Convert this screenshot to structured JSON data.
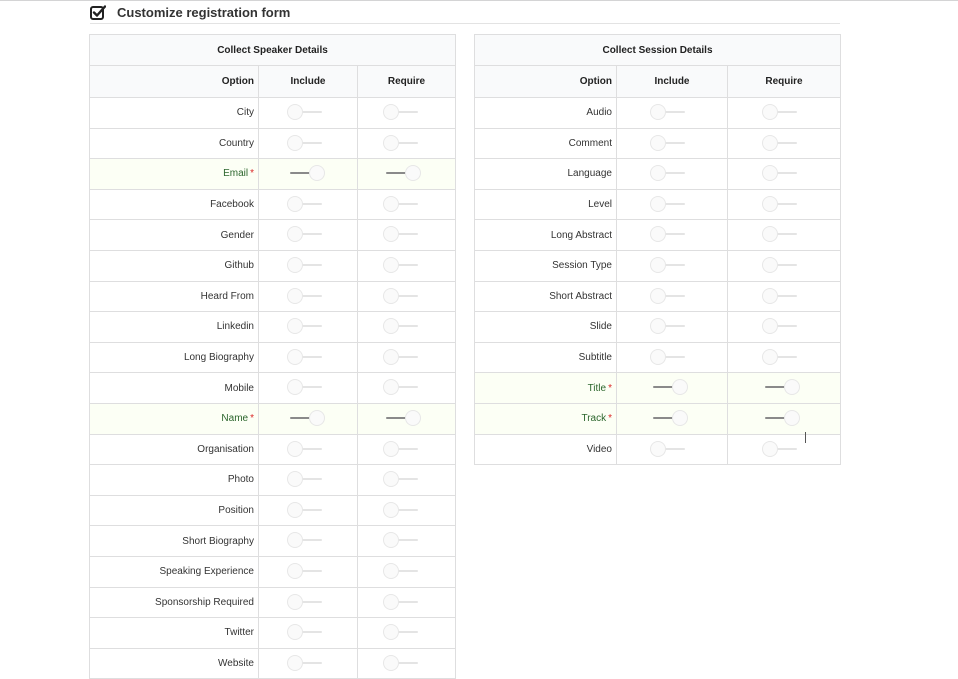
{
  "header": {
    "title": "Customize registration form",
    "checkbox_icon": "checked-checkbox-icon"
  },
  "speaker": {
    "caption": "Collect Speaker Details",
    "headers": {
      "option": "Option",
      "include": "Include",
      "require": "Require"
    },
    "rows": [
      {
        "label": "City",
        "required": false,
        "include": false,
        "require": false
      },
      {
        "label": "Country",
        "required": false,
        "include": false,
        "require": false
      },
      {
        "label": "Email",
        "required": true,
        "include": true,
        "require": true
      },
      {
        "label": "Facebook",
        "required": false,
        "include": false,
        "require": false
      },
      {
        "label": "Gender",
        "required": false,
        "include": false,
        "require": false
      },
      {
        "label": "Github",
        "required": false,
        "include": false,
        "require": false
      },
      {
        "label": "Heard From",
        "required": false,
        "include": false,
        "require": false
      },
      {
        "label": "Linkedin",
        "required": false,
        "include": false,
        "require": false
      },
      {
        "label": "Long Biography",
        "required": false,
        "include": false,
        "require": false
      },
      {
        "label": "Mobile",
        "required": false,
        "include": false,
        "require": false
      },
      {
        "label": "Name",
        "required": true,
        "include": true,
        "require": true
      },
      {
        "label": "Organisation",
        "required": false,
        "include": false,
        "require": false
      },
      {
        "label": "Photo",
        "required": false,
        "include": false,
        "require": false
      },
      {
        "label": "Position",
        "required": false,
        "include": false,
        "require": false
      },
      {
        "label": "Short Biography",
        "required": false,
        "include": false,
        "require": false
      },
      {
        "label": "Speaking Experience",
        "required": false,
        "include": false,
        "require": false
      },
      {
        "label": "Sponsorship Required",
        "required": false,
        "include": false,
        "require": false
      },
      {
        "label": "Twitter",
        "required": false,
        "include": false,
        "require": false
      },
      {
        "label": "Website",
        "required": false,
        "include": false,
        "require": false
      }
    ]
  },
  "session": {
    "caption": "Collect Session Details",
    "headers": {
      "option": "Option",
      "include": "Include",
      "require": "Require"
    },
    "rows": [
      {
        "label": "Audio",
        "required": false,
        "include": false,
        "require": false
      },
      {
        "label": "Comment",
        "required": false,
        "include": false,
        "require": false
      },
      {
        "label": "Language",
        "required": false,
        "include": false,
        "require": false
      },
      {
        "label": "Level",
        "required": false,
        "include": false,
        "require": false
      },
      {
        "label": "Long Abstract",
        "required": false,
        "include": false,
        "require": false
      },
      {
        "label": "Session Type",
        "required": false,
        "include": false,
        "require": false
      },
      {
        "label": "Short Abstract",
        "required": false,
        "include": false,
        "require": false
      },
      {
        "label": "Slide",
        "required": false,
        "include": false,
        "require": false
      },
      {
        "label": "Subtitle",
        "required": false,
        "include": false,
        "require": false
      },
      {
        "label": "Title",
        "required": true,
        "include": true,
        "require": true
      },
      {
        "label": "Track",
        "required": true,
        "include": true,
        "require": true
      },
      {
        "label": "Video",
        "required": false,
        "include": false,
        "require": false
      }
    ]
  },
  "required_marker": "*",
  "colors": {
    "highlight_row_bg": "#fcfff5",
    "highlight_text": "#2c662d",
    "required_star": "#db2828"
  }
}
